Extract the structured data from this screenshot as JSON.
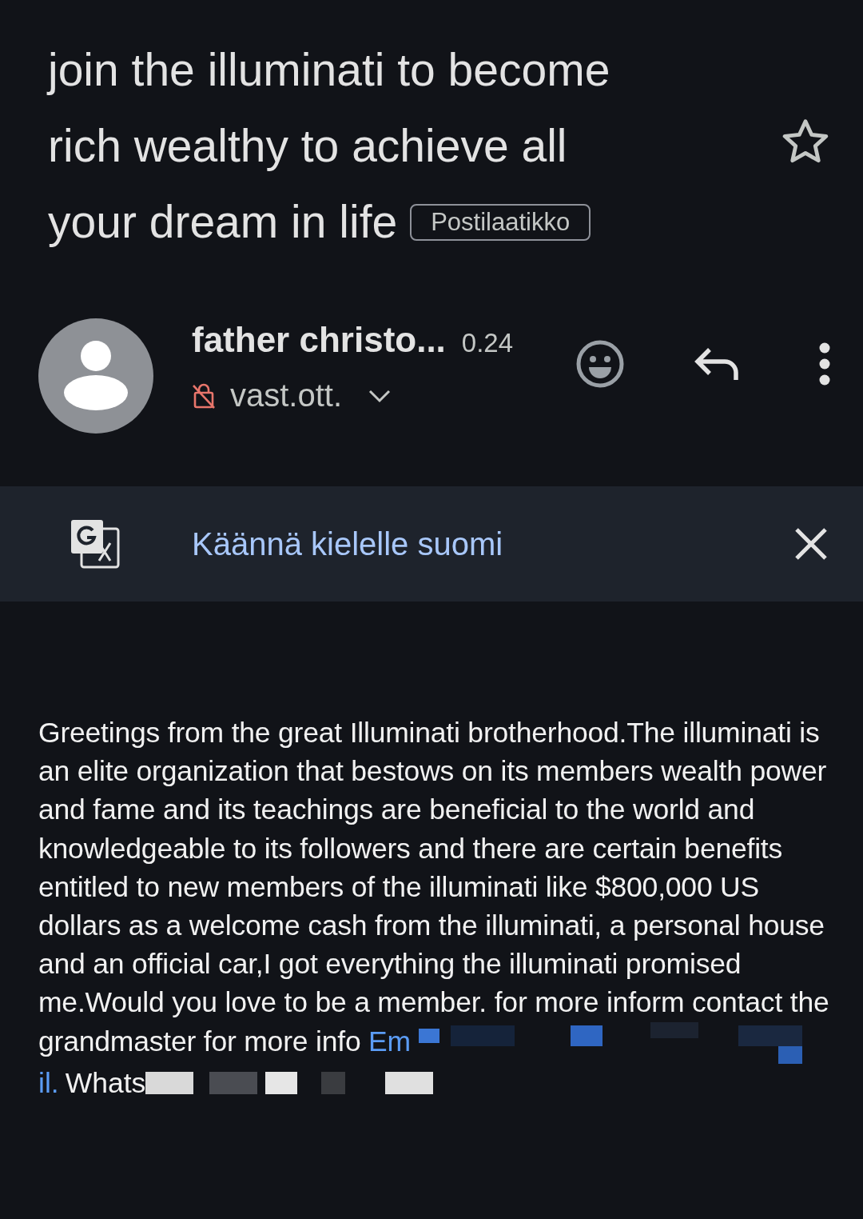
{
  "subject": {
    "lines": [
      "join the illuminati to become",
      "rich wealthy to achieve all",
      "your dream in life"
    ],
    "label": "Postilaatikko",
    "starred": false
  },
  "sender": {
    "name": "father christo...",
    "time": "0.24",
    "recipient": "vast.ott."
  },
  "translate_bar": {
    "text": "Käännä kielelle suomi"
  },
  "body": {
    "text": "Greetings from the great Illuminati brotherhood.The illuminati is an elite organization that bestows on its members wealth power and fame and its teachings are beneficial to the world and knowledgeable to its followers and there are certain benefits entitled to new members of the illuminati like $800,000 US dollars as a welcome cash from the illuminati, a personal house and an official car,I got everything the illuminati promised me.Would you love to be a member. for more inform contact the grandmaster for more info ",
    "email_start": "Em",
    "email_end": "il.",
    "whatsapp": "Whats"
  }
}
